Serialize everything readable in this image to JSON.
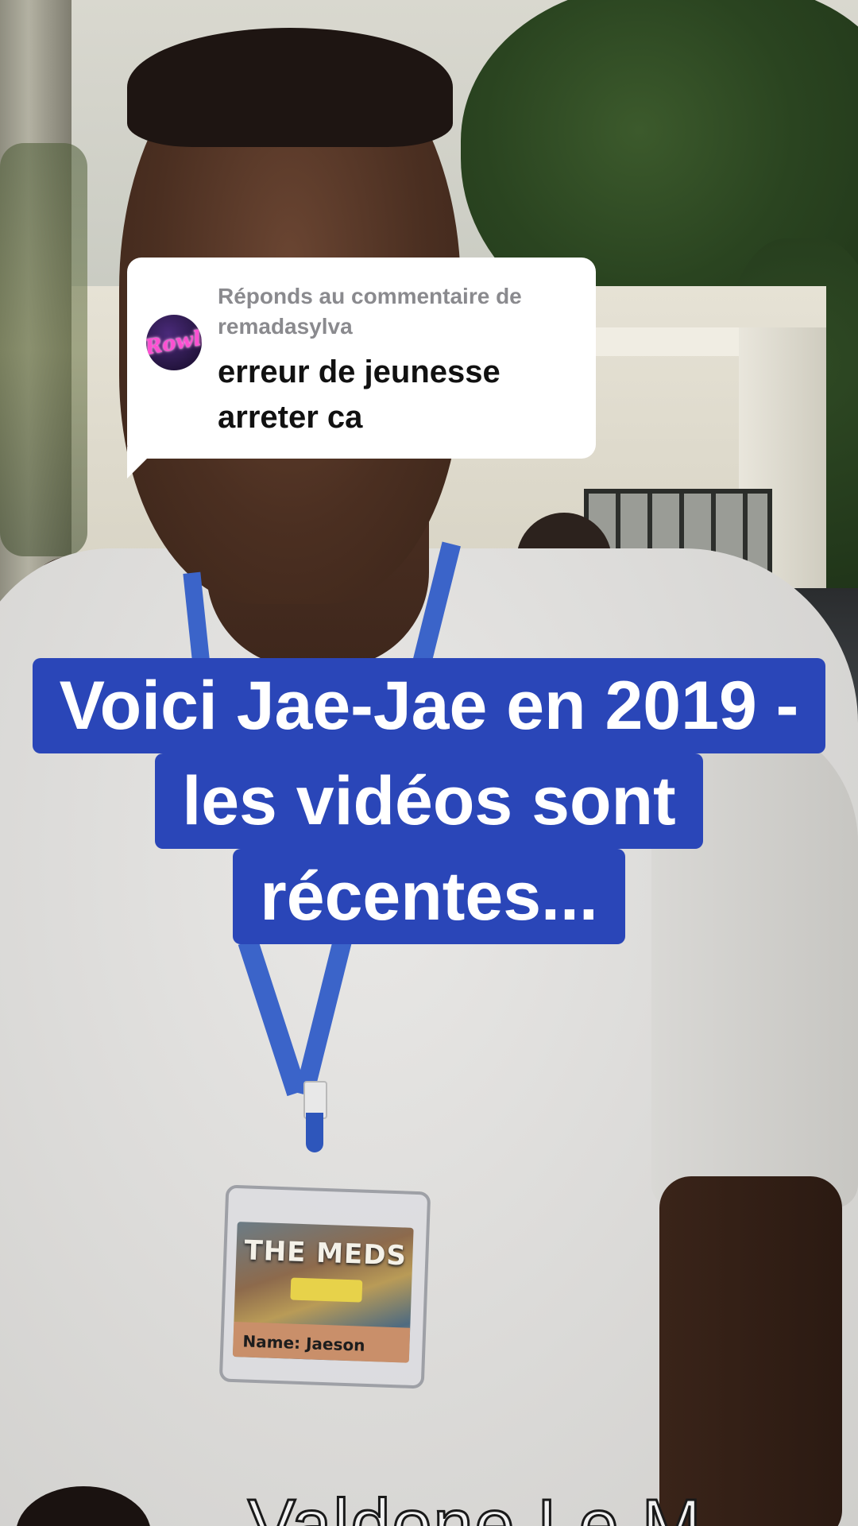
{
  "reply_sticker": {
    "label": "Réponds au commentaire de remadasylva",
    "comment": "erreur de jeunesse arreter ca",
    "avatar_text": "Rowlan"
  },
  "caption": {
    "lines": [
      "Voici Jae-Jae en 2019 -",
      "les vidéos sont",
      "récentes..."
    ],
    "background_color": "#2a46b8",
    "text_color": "#ffffff"
  },
  "badge": {
    "title": "THE MEDS",
    "name": "Name: Jaeson"
  },
  "watermark": {
    "text": "Valdone Le M"
  },
  "icons": [
    "avatar"
  ]
}
